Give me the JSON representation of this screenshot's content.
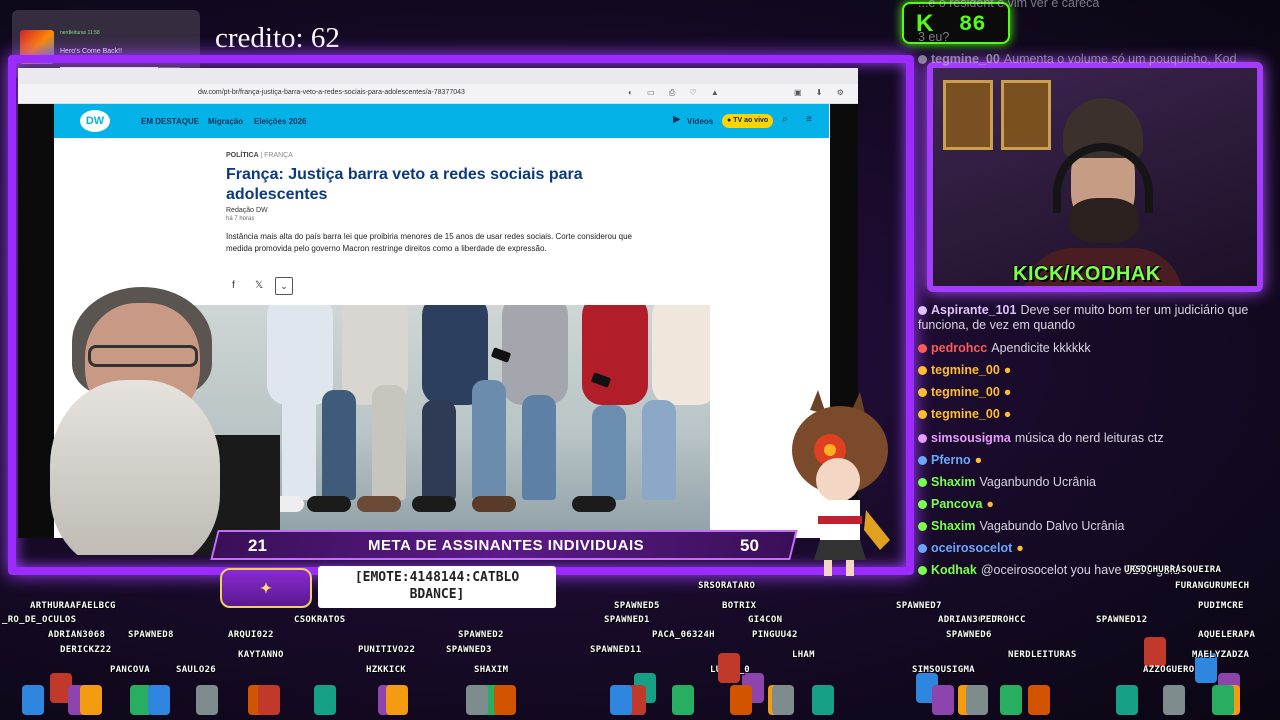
{
  "music": {
    "source": "nerdleituras",
    "source_badge": "11:58",
    "title": "Hero's Come Back!!",
    "artist": "nobodyknows+ - single",
    "progress": 0.82
  },
  "credit": "credito: 62",
  "viewers": {
    "icon": "K",
    "count": "86"
  },
  "browser": {
    "url": "dw.com/pt-br/frança-justiça-barra-veto-a-redes-sociais-para-adolescentes/a-78377043"
  },
  "dw": {
    "logo": "DW",
    "nav": [
      "EM DESTAQUE",
      "Migração",
      "Eleições 2026"
    ],
    "videos": "Vídeos",
    "live": "● TV ao vivo",
    "category": "POLÍTICA",
    "subcategory": "| FRANÇA",
    "title": "França: Justiça barra veto a redes sociais para adolescentes",
    "author": "Redação DW",
    "time": "há 7 horas",
    "lead": "Instância mais alta do país barra lei que proibiria menores de 15 anos de usar redes sociais. Corte considerou que medida promovida pelo governo Macron restringe direitos como a liberdade de expressão."
  },
  "goal": {
    "current": "21",
    "label": "META DE ASSINANTES INDIVIDUAIS",
    "target": "50"
  },
  "kick_tag": "KICK/KODHAK",
  "emote": {
    "line1": "[EMOTE:4148144:CATBLO",
    "line2": "BDANCE]"
  },
  "chat": [
    {
      "user": "",
      "text": "...e o resident e vim ver e careca",
      "color": "#d8d4e0",
      "ghost": true
    },
    {
      "user": "",
      "text": "3 eu?",
      "color": "#d8d4e0",
      "ghost": true
    },
    {
      "user": "tegmine_00",
      "text": "Aumenta o volume só um pouquinho, Kod",
      "color": "#d8d4e0",
      "ghost": true
    },
    {
      "user": "Aspirante_101",
      "text": "Deve ser muito bom ter um judiciário que funciona, de vez em quando",
      "color": "#e0c0ff"
    },
    {
      "user": "pedrohcc",
      "text": "Apendicite kkkkkk",
      "color": "#ff5a5a"
    },
    {
      "user": "tegmine_00",
      "text": "",
      "color": "#ffbe2e"
    },
    {
      "user": "tegmine_00",
      "text": "",
      "color": "#ffbe2e"
    },
    {
      "user": "tegmine_00",
      "text": "",
      "color": "#ffbe2e"
    },
    {
      "user": "simsousigma",
      "text": "música do nerd leituras ctz",
      "color": "#e89cff"
    },
    {
      "user": "Pferno",
      "text": "",
      "color": "#6aa8ff"
    },
    {
      "user": "Shaxim",
      "text": "Vaganbundo Ucrânia",
      "color": "#7cff4c"
    },
    {
      "user": "Pancova",
      "text": "",
      "color": "#7cff4c"
    },
    {
      "user": "Shaxim",
      "text": "Vagabundo Dalvo Ucrânia",
      "color": "#7cff4c"
    },
    {
      "user": "oceirosocelot",
      "text": "",
      "color": "#6aa8ff"
    },
    {
      "user": "Kodhak",
      "text": "@oceirosocelot you have 3100 gold",
      "color": "#7cff4c"
    }
  ],
  "avatars": [
    "ARTHURAAFAELBCG",
    "_RO_DE_OCULOS",
    "ADRIAN3068",
    "DERICKZ22",
    "PANCOVA",
    "SAULO26",
    "ARQUI022",
    "CSOKRATOS",
    "KAYTANNO",
    "SPAWNED8",
    "PUNITIVO22",
    "HZKKICK",
    "SPAWNED2",
    "SPAWNED3",
    "SHAXIM",
    "SPAWNED5",
    "SPAWNED1",
    "SPAWNED11",
    "BOTRIX",
    "GI4CON",
    "PACA_06324H",
    "PINGUU42",
    "LURIC_0",
    "LHAM",
    "SRSORATARO",
    "SPAWNED7",
    "SIMSOUSIGMA",
    "ADRIAN3023B",
    "PEDROHCC",
    "SPAWNED6",
    "NERDLEITURAS",
    "SPAWNED12",
    "URSOCHURRASQUEIRA",
    "FURANGURUMECH",
    "PUDIMCRE",
    "AQUELERAPA",
    "MAELYZADZA",
    "AZZOGUERO"
  ]
}
